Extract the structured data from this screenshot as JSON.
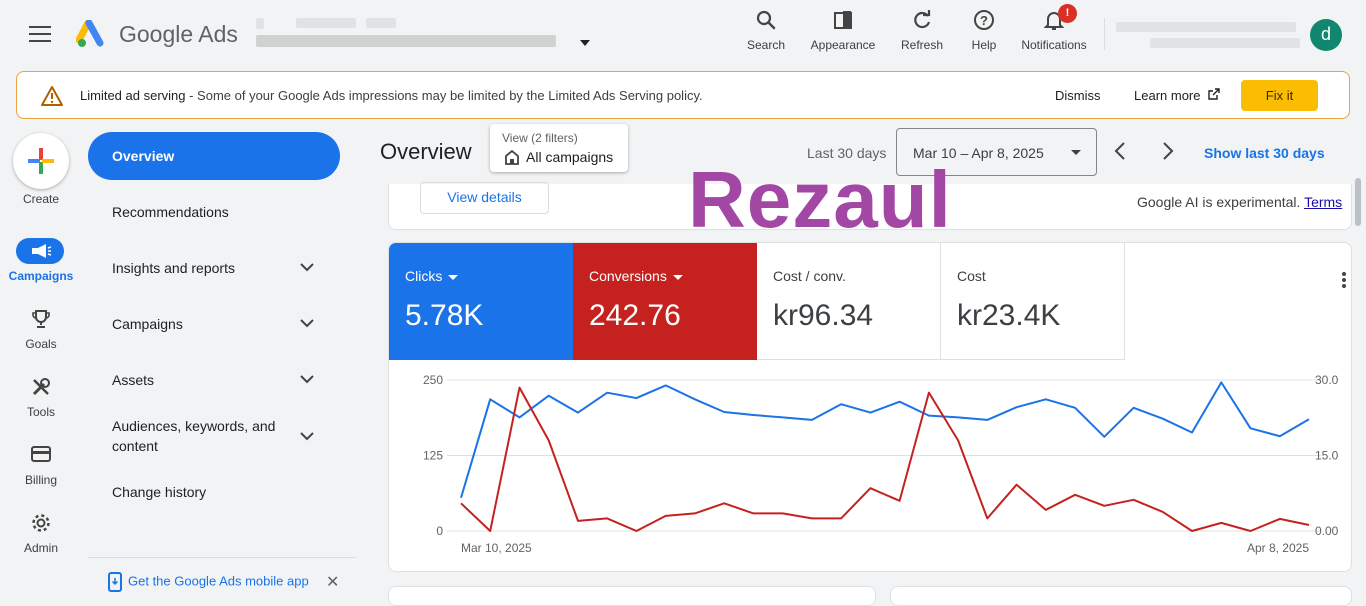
{
  "brand": {
    "name": "Google Ads"
  },
  "topbar": {
    "search": "Search",
    "appearance": "Appearance",
    "refresh": "Refresh",
    "help": "Help",
    "notifications": "Notifications",
    "notif_badge": "!",
    "avatar_letter": "d"
  },
  "banner": {
    "title": "Limited ad serving",
    "message": " - Some of your Google Ads impressions may be limited by the Limited Ads Serving policy.",
    "dismiss": "Dismiss",
    "learn_more": "Learn more",
    "fix": "Fix it"
  },
  "rail": {
    "create": "Create",
    "campaigns": "Campaigns",
    "goals": "Goals",
    "tools": "Tools",
    "billing": "Billing",
    "admin": "Admin"
  },
  "nav": {
    "overview": "Overview",
    "recommendations": "Recommendations",
    "insights": "Insights and reports",
    "campaigns": "Campaigns",
    "assets": "Assets",
    "audiences": "Audiences, keywords, and content",
    "change_history": "Change history",
    "mobile_app": "Get the Google Ads mobile app"
  },
  "header": {
    "title": "Overview",
    "filter_line1": "View (2 filters)",
    "filter_line2": "All campaigns",
    "range_label": "Last 30 days",
    "date_range": "Mar 10 – Apr 8, 2025",
    "show_last": "Show last 30 days"
  },
  "ai": {
    "view_details": "View details",
    "note": "Google AI is experimental. ",
    "terms": "Terms"
  },
  "watermark": "Rezaul",
  "metrics": [
    {
      "name": "Clicks",
      "value": "5.78K"
    },
    {
      "name": "Conversions",
      "value": "242.76"
    },
    {
      "name": "Cost / conv.",
      "value": "kr96.34"
    },
    {
      "name": "Cost",
      "value": "kr23.4K"
    }
  ],
  "colors": {
    "clicks": "#1a73e8",
    "conversions": "#c5221f"
  },
  "chart_data": {
    "type": "line",
    "x_start_label": "Mar 10, 2025",
    "x_end_label": "Apr 8, 2025",
    "left_ticks": [
      "250",
      "125",
      "0"
    ],
    "right_ticks": [
      "30.0",
      "15.0",
      "0.00"
    ],
    "ylim_left": [
      0,
      250
    ],
    "ylim_right": [
      0,
      30
    ],
    "grid": true,
    "series": [
      {
        "name": "Clicks",
        "axis": "left",
        "values": [
          55,
          218,
          188,
          224,
          196,
          229,
          220,
          241,
          218,
          197,
          192,
          188,
          184,
          210,
          196,
          214,
          191,
          188,
          184,
          205,
          218,
          204,
          156,
          204,
          186,
          163,
          246,
          170,
          157,
          185
        ]
      },
      {
        "name": "Conversions",
        "axis": "right",
        "values": [
          5.5,
          0,
          28.5,
          18,
          2,
          2.5,
          0,
          3,
          3.5,
          5.5,
          3.5,
          3.5,
          2.5,
          2.5,
          8.5,
          6,
          27.5,
          18,
          2.5,
          9.2,
          4.2,
          7.2,
          5,
          6.2,
          3.8,
          0,
          1.6,
          0,
          2.4,
          1.2
        ]
      }
    ]
  }
}
